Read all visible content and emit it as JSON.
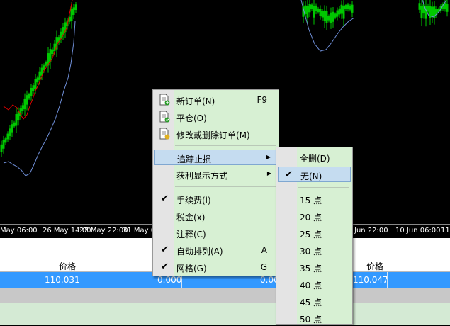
{
  "time_axis": [
    "May 06:00",
    "26 May 14:00",
    "27 May 22:00",
    "31 May 0",
    "Jun 22:00",
    "10 Jun 06:00",
    "11"
  ],
  "grid": {
    "headers": [
      "价格",
      "价格"
    ],
    "row": {
      "price_left": "110.031",
      "val1": "0.000",
      "val2": "0.00",
      "price_right": "110.047"
    }
  },
  "main_menu": {
    "items": [
      {
        "label": "新订单(N)",
        "accel": "F9",
        "icon": "new-order-icon"
      },
      {
        "label": "平仓(O)",
        "icon": "close-position-icon"
      },
      {
        "label": "修改或删除订单(M)",
        "icon": "modify-order-icon"
      },
      {
        "label": "追踪止损",
        "submenu": true
      },
      {
        "label": "获利显示方式",
        "submenu": true
      },
      {
        "label": "手续费(i)",
        "checked": true
      },
      {
        "label": "税金(x)"
      },
      {
        "label": "注释(C)"
      },
      {
        "label": "自动排列(A)",
        "accel": "A",
        "checked": true
      },
      {
        "label": "网格(G)",
        "accel": "G",
        "checked": true
      }
    ]
  },
  "sub_menu": {
    "items": [
      {
        "label": "全删(D)"
      },
      {
        "label": "无(N)",
        "checked": true
      },
      {
        "label": "15 点"
      },
      {
        "label": "20 点"
      },
      {
        "label": "25 点"
      },
      {
        "label": "30 点"
      },
      {
        "label": "35 点"
      },
      {
        "label": "40 点"
      },
      {
        "label": "45 点"
      },
      {
        "label": "50 点"
      }
    ]
  }
}
